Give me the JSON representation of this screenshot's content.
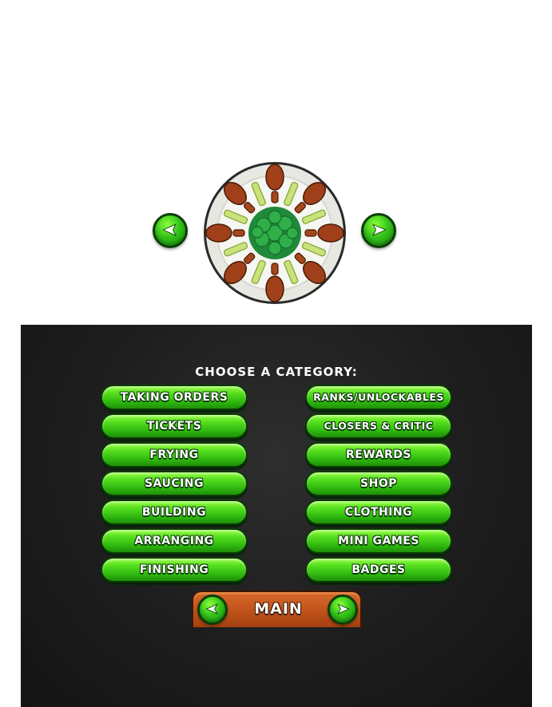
{
  "preview": {
    "prev_icon": "left-arrow-icon",
    "next_icon": "right-arrow-icon",
    "plate_icon": "wings-plate-icon"
  },
  "menu": {
    "title": "CHOOSE A CATEGORY:",
    "left_buttons": [
      "TAKING ORDERS",
      "TICKETS",
      "FRYING",
      "SAUCING",
      "BUILDING",
      "ARRANGING",
      "FINISHING"
    ],
    "right_buttons": [
      "RANKS/UNLOCKABLES",
      "CLOSERS & CRITIC",
      "REWARDS",
      "SHOP",
      "CLOTHING",
      "MINI GAMES",
      "BADGES"
    ]
  },
  "nav": {
    "label": "MAIN"
  },
  "colors": {
    "button_green": "#35c41a",
    "panel_dark": "#1d1d1d",
    "plank_orange": "#c6561d"
  }
}
